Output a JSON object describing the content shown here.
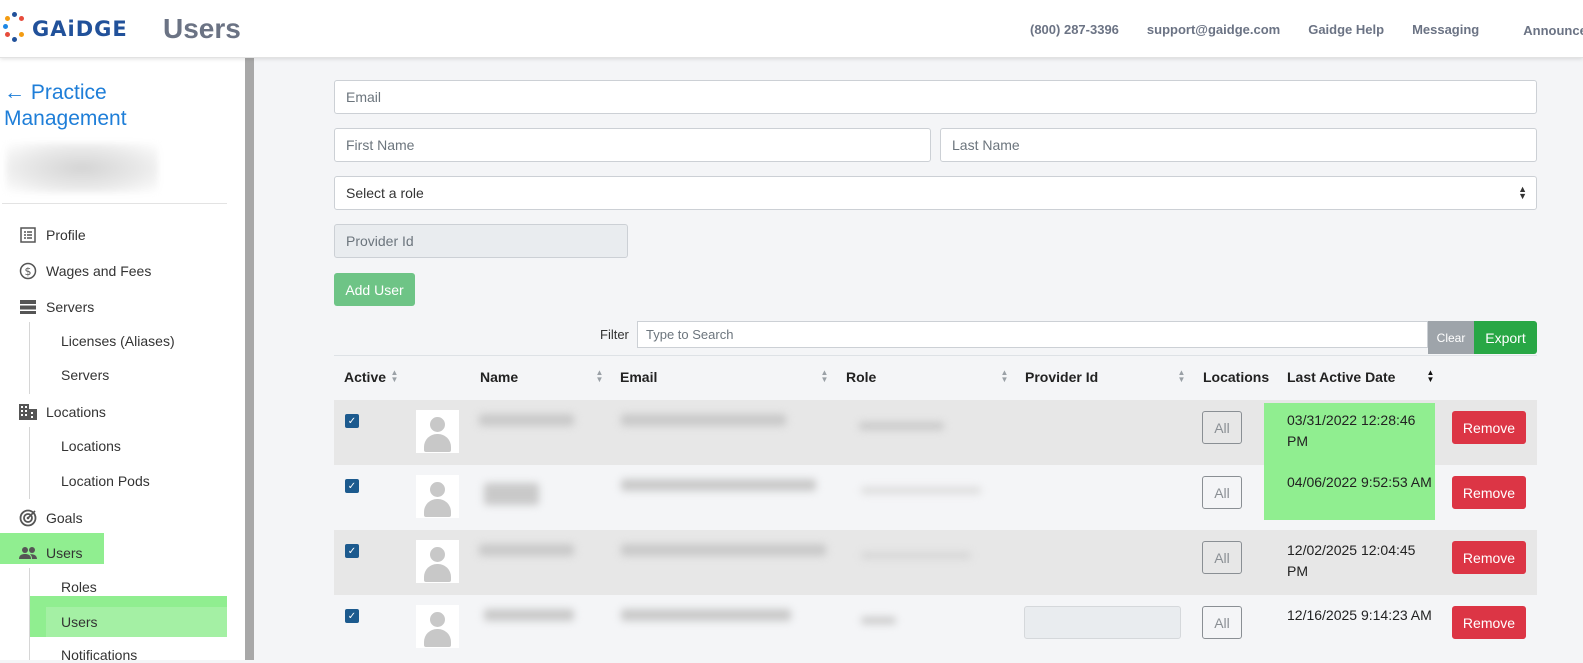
{
  "header": {
    "logo_text": "GAiDGE",
    "page_title": "Users",
    "links": [
      "(800) 287-3396",
      "support@gaidge.com",
      "Gaidge Help",
      "Messaging",
      "Announcer"
    ]
  },
  "sidebar": {
    "back_link": "← Practice Management",
    "nav": {
      "profile": "Profile",
      "wages": "Wages and Fees",
      "servers": "Servers",
      "licenses": "Licenses (Aliases)",
      "servers_sub": "Servers",
      "locations": "Locations",
      "locations_sub": "Locations",
      "location_pods": "Location Pods",
      "goals": "Goals",
      "users": "Users",
      "roles": "Roles",
      "users_sub": "Users",
      "notifications": "Notifications"
    }
  },
  "form": {
    "email_placeholder": "Email",
    "first_name_placeholder": "First Name",
    "last_name_placeholder": "Last Name",
    "role_select": "Select a role",
    "provider_placeholder": "Provider Id",
    "add_user": "Add User"
  },
  "filter": {
    "label": "Filter",
    "placeholder": "Type to Search",
    "clear": "Clear",
    "export": "Export"
  },
  "table": {
    "columns": {
      "active": "Active",
      "name": "Name",
      "email": "Email",
      "role": "Role",
      "provider_id": "Provider Id",
      "locations": "Locations",
      "last_active": "Last Active Date"
    },
    "rows": [
      {
        "locations": "All",
        "last_active": "03/31/2022 12:28:46 PM",
        "action": "Remove",
        "highlight": true
      },
      {
        "locations": "All",
        "last_active": "04/06/2022 9:52:53 AM",
        "action": "Remove",
        "highlight": true
      },
      {
        "locations": "All",
        "last_active": "12/02/2025 12:04:45 PM",
        "action": "Remove",
        "highlight": false
      },
      {
        "locations": "All",
        "last_active": "12/16/2025 9:14:23 AM",
        "action": "Remove",
        "highlight": false
      }
    ]
  },
  "colors": {
    "brand": "#21519a",
    "highlight": "#90ee90",
    "danger": "#dc3545",
    "success": "#28a745"
  }
}
